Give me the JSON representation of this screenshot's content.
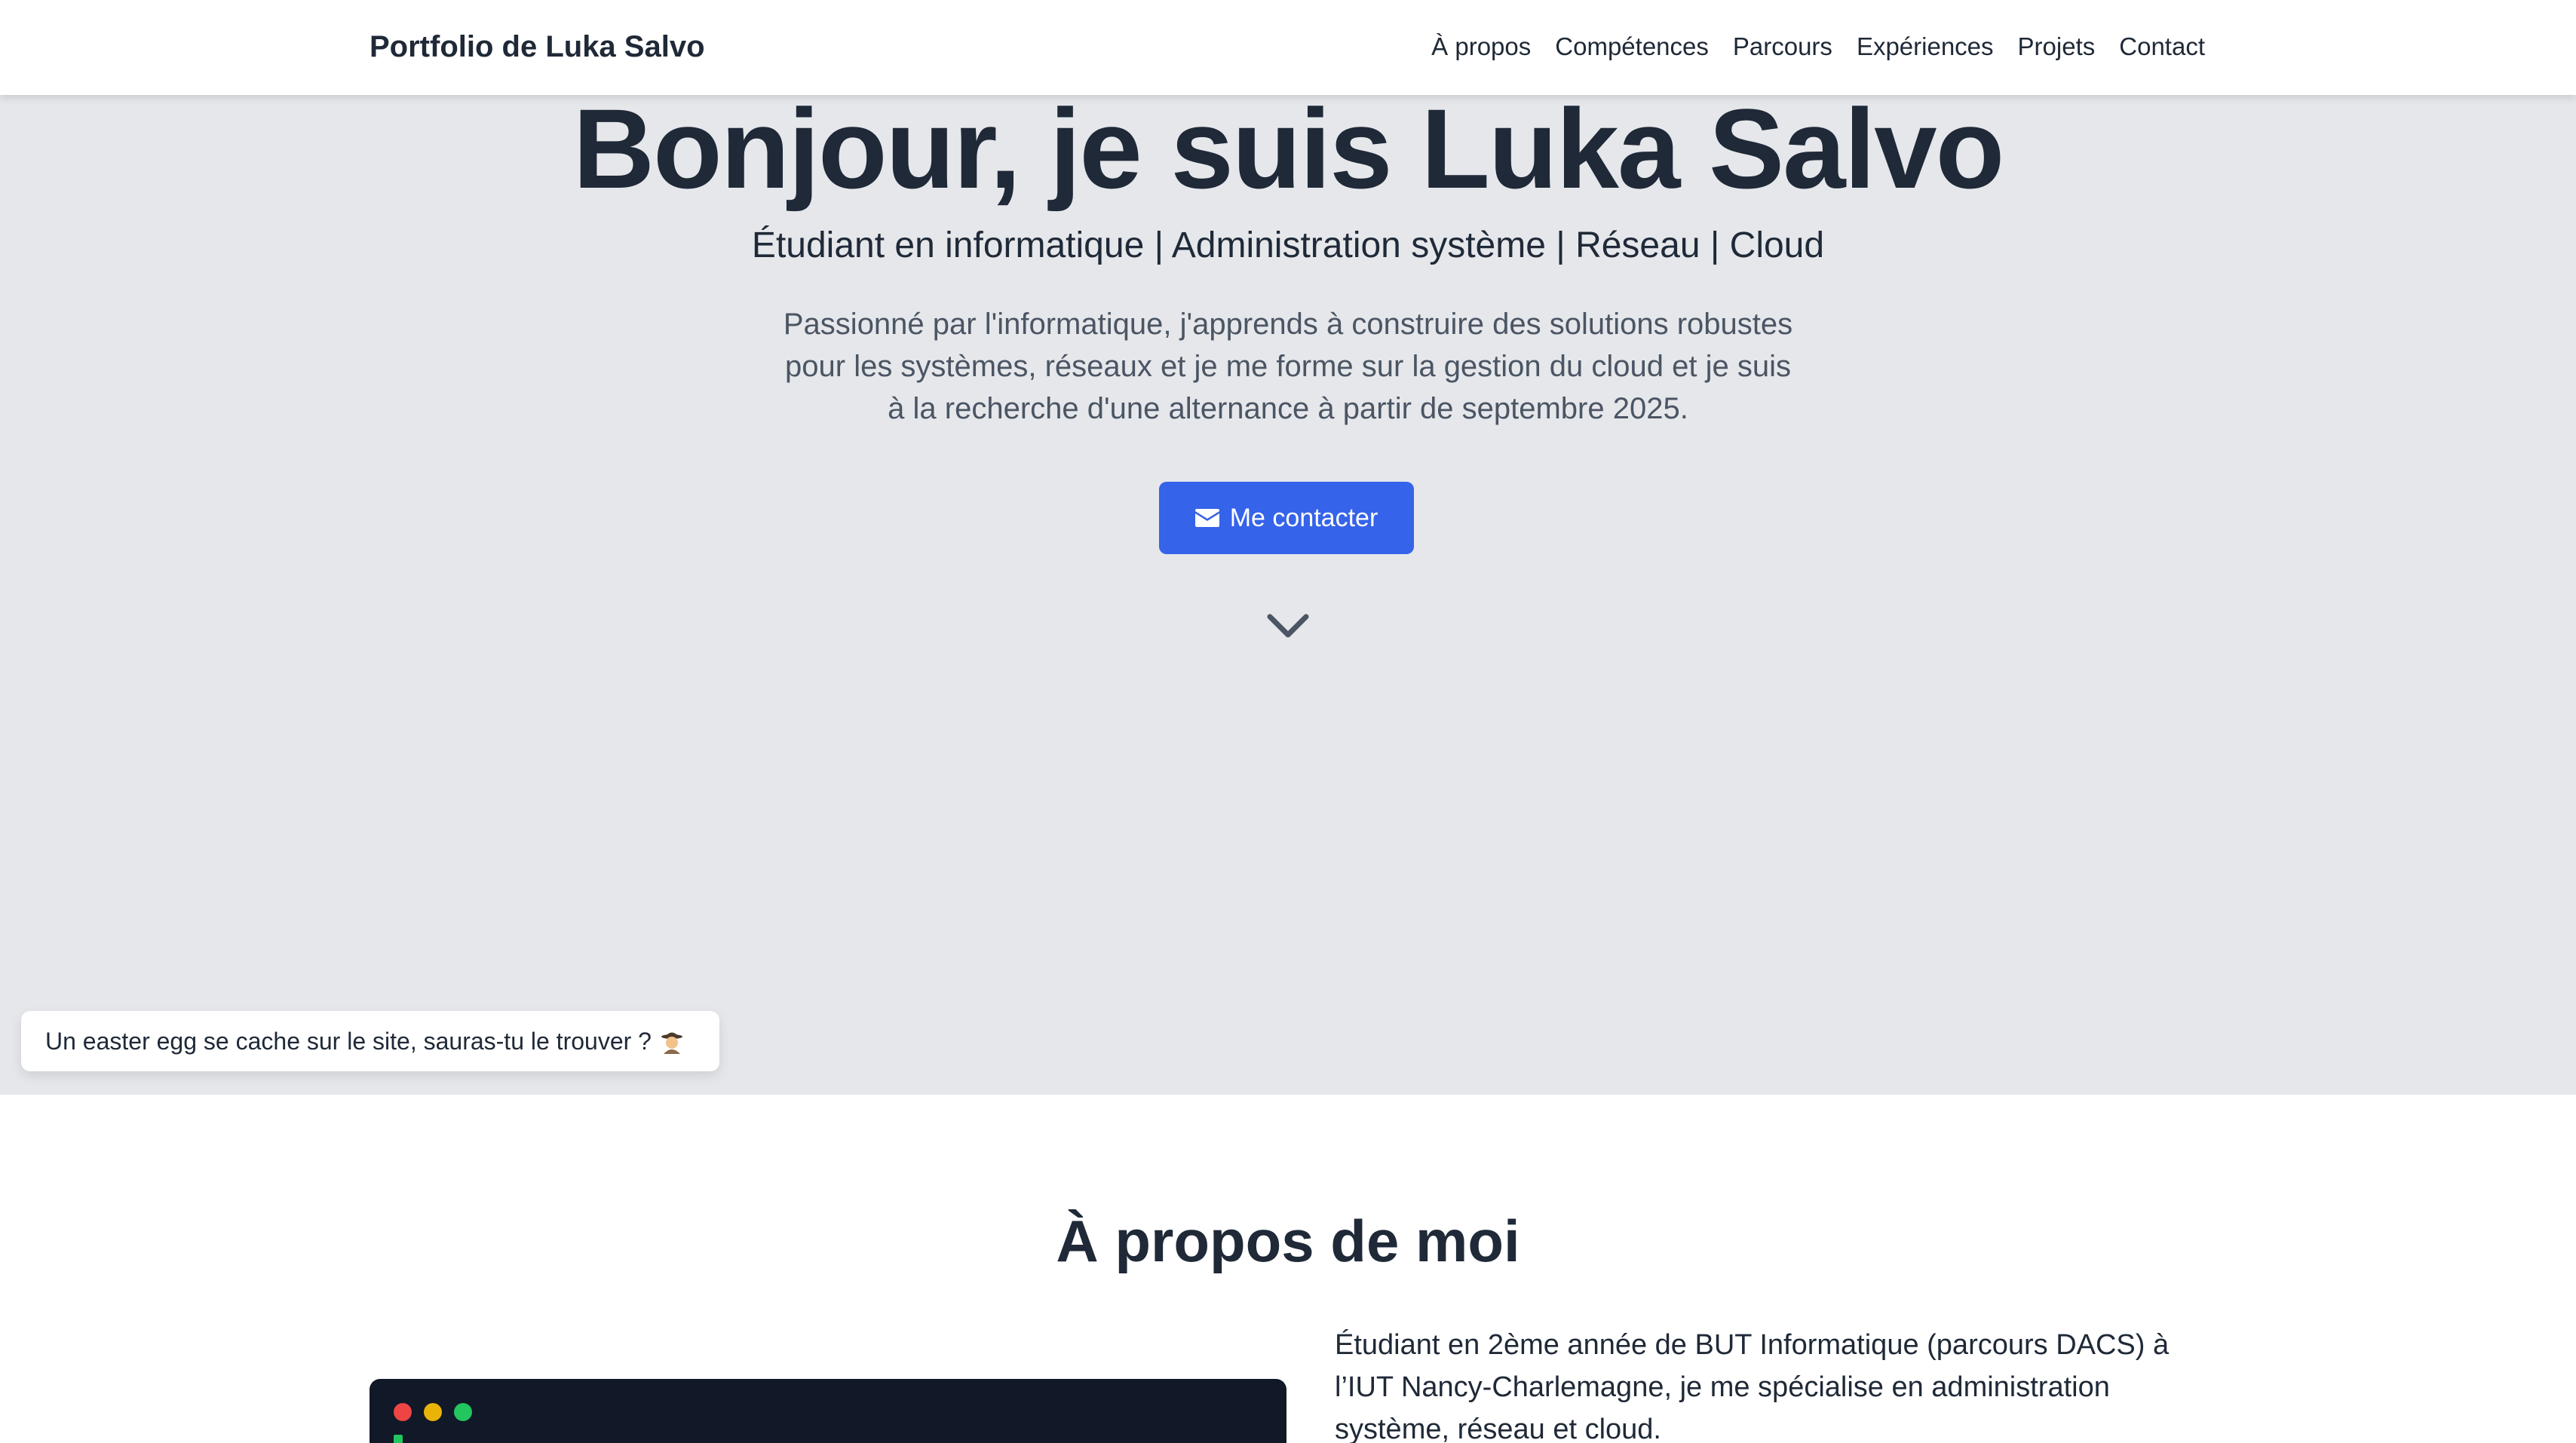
{
  "navbar": {
    "brand": "Portfolio de Luka Salvo",
    "links": [
      "À propos",
      "Compétences",
      "Parcours",
      "Expériences",
      "Projets",
      "Contact"
    ]
  },
  "hero": {
    "title": "Bonjour, je suis Luka Salvo",
    "subtitle": "Étudiant en informatique | Administration système | Réseau | Cloud",
    "description": "Passionné par l'informatique, j'apprends à construire des solutions robustes pour les systèmes, réseaux et je me forme sur la gestion du cloud et je suis à la recherche d'une alternance à partir de septembre 2025.",
    "cta_label": "Me contacter",
    "cta_icon": "envelope-icon",
    "scroll_icon": "chevron-down-icon"
  },
  "toast": {
    "text": "Un easter egg se cache sur le site, sauras-tu le trouver ?",
    "icon": "detective-icon"
  },
  "about": {
    "title": "À propos de moi",
    "text": "Étudiant en 2ème année de BUT Informatique (parcours DACS) à l’IUT Nancy-Charlemagne, je me spécialise en administration système, réseau et cloud."
  },
  "colors": {
    "hero_bg": "#e5e7eb",
    "accent": "#3563e9",
    "text_dark": "#1f2937",
    "text_muted": "#4b5563",
    "terminal_bg": "#111827"
  }
}
